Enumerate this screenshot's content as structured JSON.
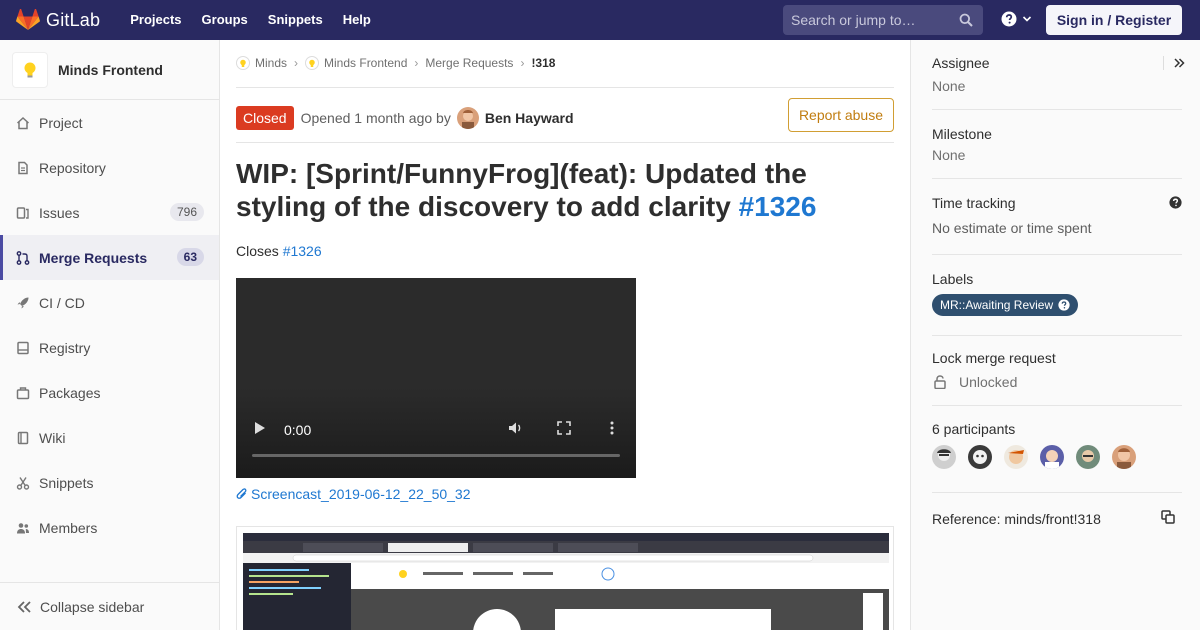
{
  "navbar": {
    "brand": "GitLab",
    "links": [
      "Projects",
      "Groups",
      "Snippets",
      "Help"
    ],
    "search_placeholder": "Search or jump to…",
    "signin": "Sign in / Register",
    "accent": "#292961"
  },
  "sidebar": {
    "project_name": "Minds Frontend",
    "items": [
      {
        "label": "Project",
        "icon": "home-icon"
      },
      {
        "label": "Repository",
        "icon": "doc-icon"
      },
      {
        "label": "Issues",
        "icon": "issues-icon",
        "count": "796"
      },
      {
        "label": "Merge Requests",
        "icon": "merge-icon",
        "count": "63",
        "active": true
      },
      {
        "label": "CI / CD",
        "icon": "rocket-icon"
      },
      {
        "label": "Registry",
        "icon": "registry-icon"
      },
      {
        "label": "Packages",
        "icon": "package-icon"
      },
      {
        "label": "Wiki",
        "icon": "book-icon"
      },
      {
        "label": "Snippets",
        "icon": "scissors-icon"
      },
      {
        "label": "Members",
        "icon": "users-icon"
      }
    ],
    "collapse_label": "Collapse sidebar"
  },
  "breadcrumbs": [
    "Minds",
    "Minds Frontend",
    "Merge Requests",
    "!318"
  ],
  "status": {
    "badge": "Closed",
    "opened": "Opened 1 month ago by",
    "author": "Ben Hayward",
    "report": "Report abuse",
    "badge_color": "#db3b21"
  },
  "title": {
    "text": "WIP: [Sprint/FunnyFrog](feat): Updated the styling of the discovery to add clarity",
    "ref": "#1326"
  },
  "description": {
    "closes_prefix": "Closes",
    "closes_ref": "#1326",
    "video_time": "0:00",
    "attachment": "Screencast_2019-06-12_22_50_32"
  },
  "right_sidebar": {
    "assignee_title": "Assignee",
    "assignee_value": "None",
    "milestone_title": "Milestone",
    "milestone_value": "None",
    "time_title": "Time tracking",
    "time_value": "No estimate or time spent",
    "labels_title": "Labels",
    "label": "MR::Awaiting Review",
    "lock_title": "Lock merge request",
    "lock_value": "Unlocked",
    "participants_title": "6 participants",
    "reference": "Reference: minds/front!318"
  }
}
